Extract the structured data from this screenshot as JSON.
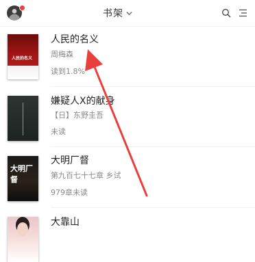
{
  "header": {
    "title": "书架"
  },
  "colors": {
    "accent": "#e23b3b",
    "arrow": "#e8403a",
    "text_secondary": "#888888"
  },
  "icons": {
    "avatar": "user-avatar",
    "title_dropdown": "chevron-down-icon",
    "search": "search-icon",
    "menu": "menu-icon"
  },
  "books": [
    {
      "name": "人民的名义",
      "author": "周梅森",
      "status": "读到1.8%",
      "progress_percent": 1.8,
      "cover_text": "人民的名义"
    },
    {
      "name": "嫌疑人X的献身",
      "author": "【日】东野圭吾",
      "status": "未读"
    },
    {
      "name": "大明厂督",
      "author": "第九百七十七章 乡试",
      "status": "979章未读",
      "cover_text": "大明厂督"
    },
    {
      "name": "大靠山",
      "author": "",
      "status": ""
    }
  ]
}
